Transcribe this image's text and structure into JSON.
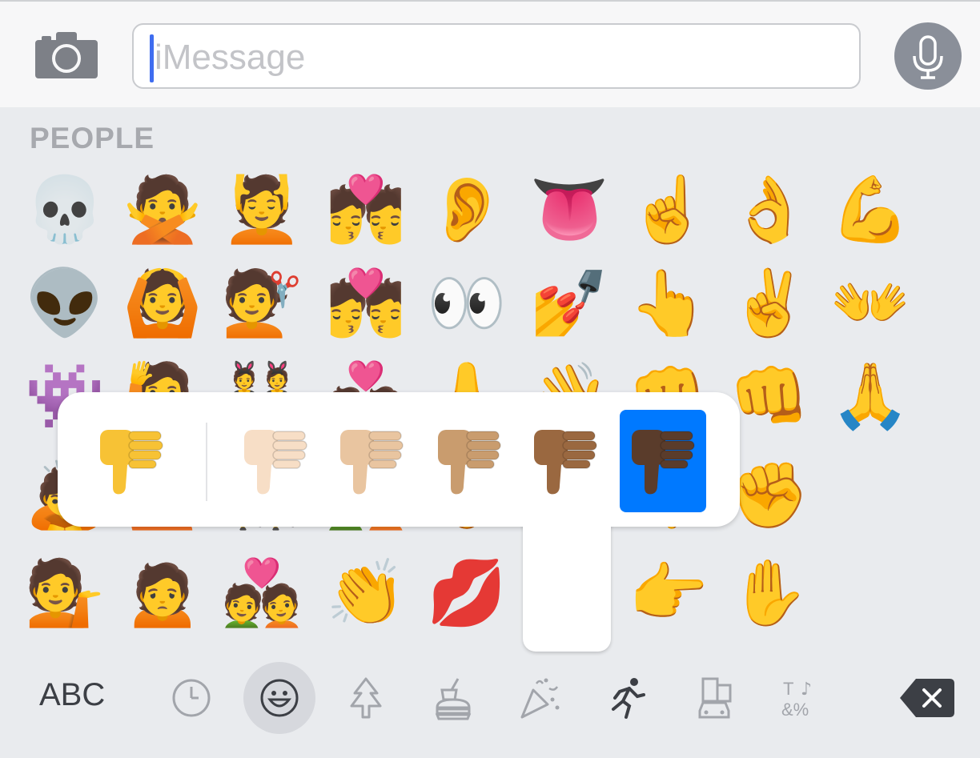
{
  "message_bar": {
    "placeholder": "iMessage",
    "camera_icon": "camera-icon",
    "mic_icon": "microphone-icon"
  },
  "keyboard": {
    "section_title": "PEOPLE",
    "emoji_rows": [
      [
        "💀",
        "🙅",
        "💆",
        "💏",
        "👂",
        "👅",
        "☝️",
        "👌",
        "💪"
      ],
      [
        "👽",
        "🙆",
        "💇",
        "💏",
        "👀",
        "💅",
        "👆",
        "✌️",
        "👐"
      ],
      [
        "👾",
        "🙋",
        "👯",
        "💑",
        "👃",
        "👋",
        "👊",
        "👊",
        "🙏"
      ],
      [
        "🙇",
        "🙋",
        "👯",
        "💑",
        "👃",
        "👋",
        "👎",
        "✊",
        ""
      ],
      [
        "💁",
        "🙍",
        "💑",
        "👏",
        "💋",
        "",
        "👉",
        "✋",
        ""
      ]
    ],
    "skin_tone_popup": {
      "emoji": "👎",
      "selected_index": 5,
      "variants": [
        "👎",
        "👎🏻",
        "👎🏼",
        "👎🏽",
        "👎🏾",
        "👎🏿"
      ],
      "tone_colors": [
        "#f7c235",
        "#f7dec6",
        "#e9c5a0",
        "#c99c6e",
        "#9a6840",
        "#5a3c2b"
      ]
    }
  },
  "bottom_bar": {
    "abc_label": "ABC",
    "categories": [
      {
        "icon": "recent-clock-icon"
      },
      {
        "icon": "smiley-icon",
        "active": true
      },
      {
        "icon": "tree-icon"
      },
      {
        "icon": "food-icon"
      },
      {
        "icon": "party-popper-icon"
      },
      {
        "icon": "running-person-icon"
      },
      {
        "icon": "buildings-car-icon"
      },
      {
        "icon": "symbols-icon"
      }
    ],
    "delete_icon": "delete-backspace-icon"
  },
  "colors": {
    "selected_blue": "#0079ff",
    "caret_blue": "#3f6df0",
    "keyboard_bg": "#e9ebee",
    "mic_gray": "#8a8f99"
  }
}
